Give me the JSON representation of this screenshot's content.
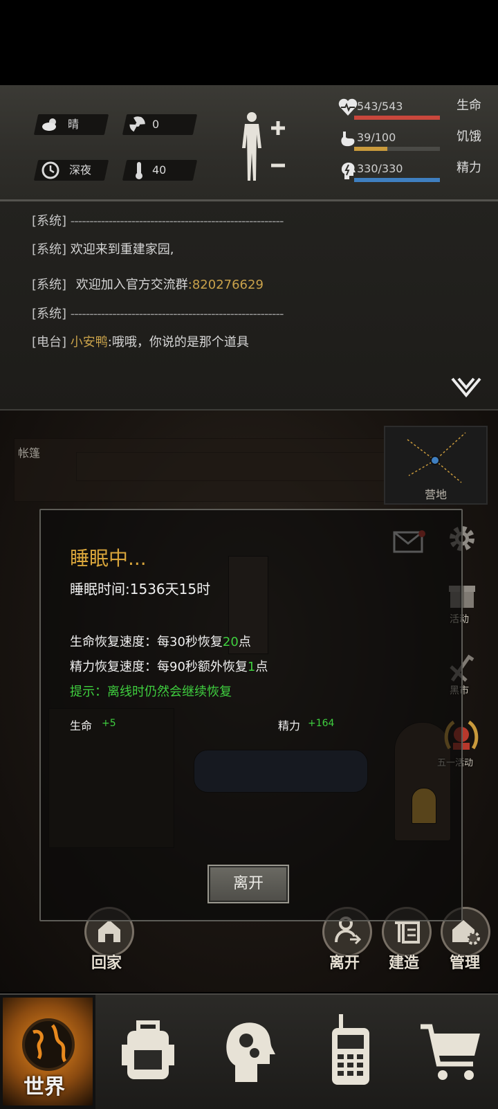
{
  "status": {
    "weather": {
      "icon": "cloud-sun-icon",
      "label": "晴"
    },
    "radiation": {
      "icon": "radiation-icon",
      "value": "0"
    },
    "time_of_day": {
      "icon": "clock-icon",
      "label": "深夜"
    },
    "temperature": {
      "icon": "thermometer-icon",
      "value": "40"
    },
    "stats": [
      {
        "icon": "heart-pulse-icon",
        "value": "543/543",
        "name": "生命",
        "fill": 1.0,
        "color": "#c9473c"
      },
      {
        "icon": "stomach-icon",
        "value": "39/100",
        "name": "饥饿",
        "fill": 0.39,
        "color": "#c99a3c"
      },
      {
        "icon": "energy-head-icon",
        "value": "330/330",
        "name": "精力",
        "fill": 1.0,
        "color": "#3f7fc0"
      }
    ]
  },
  "chat": [
    {
      "tag": "[系统]",
      "text": "--------------------------------------------------------"
    },
    {
      "tag": "[系统]",
      "text": "欢迎来到重建家园,"
    },
    {
      "tag": "[系统]",
      "text": "欢迎加入官方交流群",
      "highlight": ":820276629"
    },
    {
      "tag": "[系统]",
      "text": "--------------------------------------------------------"
    },
    {
      "tag": "[电台]",
      "sender": "小安鸭",
      "text": ":哦哦，你说的是那个道具"
    }
  ],
  "scene": {
    "location_label": "帐篷",
    "minimap_label": "营地",
    "side_buttons": [
      "活动",
      "黑市",
      "五一活动"
    ]
  },
  "sleep_dialog": {
    "title": "睡眠中...",
    "duration_label": "睡眠时间:",
    "duration_value": "1536天15时",
    "hp_rate_prefix": "生命恢复速度：每30秒恢复",
    "hp_rate_amount": "20",
    "hp_rate_suffix": "点",
    "energy_rate_prefix": "精力恢复速度：每90秒额外恢复",
    "energy_rate_amount": "1",
    "energy_rate_suffix": "点",
    "tip": "提示：离线时仍然会继续恢复",
    "gain_hp_label": "生命",
    "gain_hp_value": "+5",
    "gain_energy_label": "精力",
    "gain_energy_value": "+164",
    "leave_label": "离开"
  },
  "actions": {
    "home": "回家",
    "leave": "离开",
    "build": "建造",
    "manage": "管理"
  },
  "nav": {
    "world": "世界",
    "accent": "#e8891e"
  }
}
